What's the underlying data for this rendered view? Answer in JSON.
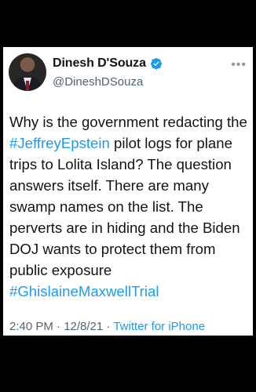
{
  "tweet": {
    "author": {
      "display_name": "Dinesh D'Souza",
      "handle": "@DineshDSouza",
      "verified_icon": "verified-badge-icon"
    },
    "more_icon": "more-horizontal-icon",
    "body": {
      "text1": "Why is the government redacting the ",
      "hashtag1": "#JeffreyEpstein",
      "text2": " pilot logs for plane trips to Lolita Island? The question answers itself. There are many swamp names on the list. The perverts are in hiding and the Biden DOJ wants to protect them from public exposure ",
      "hashtag2": "#GhislaineMaxwellTrial"
    },
    "meta": {
      "timestamp": "2:40 PM · 12/8/21",
      "separator": " · ",
      "source": "Twitter for iPhone"
    },
    "colors": {
      "link": "#1d9bf0",
      "text": "#0f1419",
      "secondary": "#536471",
      "background": "#ffffff",
      "frame": "#000000"
    }
  }
}
